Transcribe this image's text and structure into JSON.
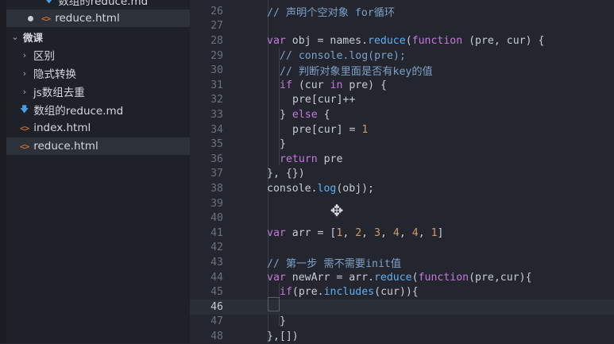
{
  "sidebar": {
    "items": [
      {
        "kind": "file-md-partial",
        "label": "数组的reduce.md"
      },
      {
        "kind": "open-file",
        "label": "reduce.html"
      },
      {
        "kind": "folder-open",
        "label": "微课"
      },
      {
        "kind": "folder",
        "label": "区别"
      },
      {
        "kind": "folder",
        "label": "隐式转换"
      },
      {
        "kind": "folder",
        "label": "js数组去重"
      },
      {
        "kind": "file-md",
        "label": "数组的reduce.md"
      },
      {
        "kind": "file-html",
        "label": "index.html"
      },
      {
        "kind": "file-html",
        "label": "reduce.html"
      }
    ]
  },
  "editor": {
    "lines": [
      {
        "n": "26"
      },
      {
        "n": "27"
      },
      {
        "n": "28"
      },
      {
        "n": "29"
      },
      {
        "n": "30"
      },
      {
        "n": "31"
      },
      {
        "n": "32"
      },
      {
        "n": "33"
      },
      {
        "n": "34"
      },
      {
        "n": "35"
      },
      {
        "n": "36"
      },
      {
        "n": "37"
      },
      {
        "n": "38"
      },
      {
        "n": "39"
      },
      {
        "n": "40"
      },
      {
        "n": "41"
      },
      {
        "n": "42"
      },
      {
        "n": "43"
      },
      {
        "n": "44"
      },
      {
        "n": "45"
      },
      {
        "n": "46"
      },
      {
        "n": "47"
      },
      {
        "n": "48"
      }
    ],
    "code": {
      "l26": "// 声明个空对象 for循环",
      "l28a": "var",
      "l28b": " obj = names.",
      "l28c": "reduce",
      "l28d": "(",
      "l28e": "function",
      "l28f": " (pre, cur) {",
      "l29": "// console.log(pre);",
      "l30": "// 判断对象里面是否有key的值",
      "l31a": "if",
      "l31b": " (cur ",
      "l31c": "in",
      "l31d": " pre) {",
      "l32": "pre[cur]++",
      "l33a": "} ",
      "l33b": "else",
      "l33c": " {",
      "l34a": "pre[cur] = ",
      "l34b": "1",
      "l35": "}",
      "l36a": "return",
      "l36b": " pre",
      "l37": "}, {})",
      "l38a": "console",
      "l38b": ".",
      "l38c": "log",
      "l38d": "(obj);",
      "l41a": "var",
      "l41b": " arr = [",
      "l41c": "1",
      "l41d": ", ",
      "l41e": "2",
      "l41f": ", ",
      "l41g": "3",
      "l41h": ", ",
      "l41i": "4",
      "l41j": ", ",
      "l41k": "4",
      "l41l": ", ",
      "l41m": "1",
      "l41n": "]",
      "l43": "// 第一步 需不需要init值",
      "l44a": "var",
      "l44b": " newArr = arr.",
      "l44c": "reduce",
      "l44d": "(",
      "l44e": "function",
      "l44f": "(pre,cur){",
      "l45a": "if",
      "l45b": "(pre.",
      "l45c": "includes",
      "l45d": "(cur)){",
      "l47": "}",
      "l48": "},[])"
    }
  }
}
